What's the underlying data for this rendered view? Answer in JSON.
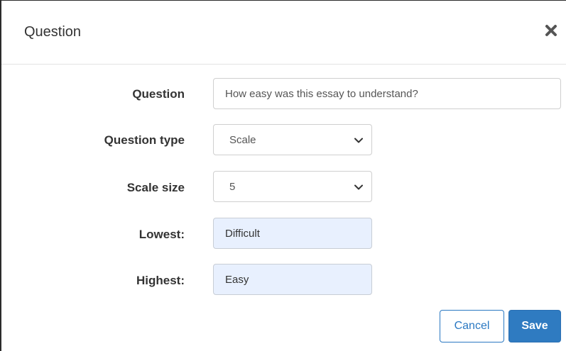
{
  "dialog": {
    "title": "Question",
    "close_icon": "close-icon"
  },
  "form": {
    "question": {
      "label": "Question",
      "value": "How easy was this essay to understand?"
    },
    "question_type": {
      "label": "Question type",
      "value": "Scale",
      "icon": "chevron-down-icon"
    },
    "scale_size": {
      "label": "Scale size",
      "value": "5",
      "icon": "chevron-down-icon"
    },
    "lowest": {
      "label": "Lowest:",
      "value": "Difficult"
    },
    "highest": {
      "label": "Highest:",
      "value": "Easy"
    }
  },
  "buttons": {
    "cancel": "Cancel",
    "save": "Save"
  },
  "colors": {
    "primary": "#2f7bc1",
    "autofill_bg": "#e8f0fe",
    "border": "#cfcfcf"
  }
}
